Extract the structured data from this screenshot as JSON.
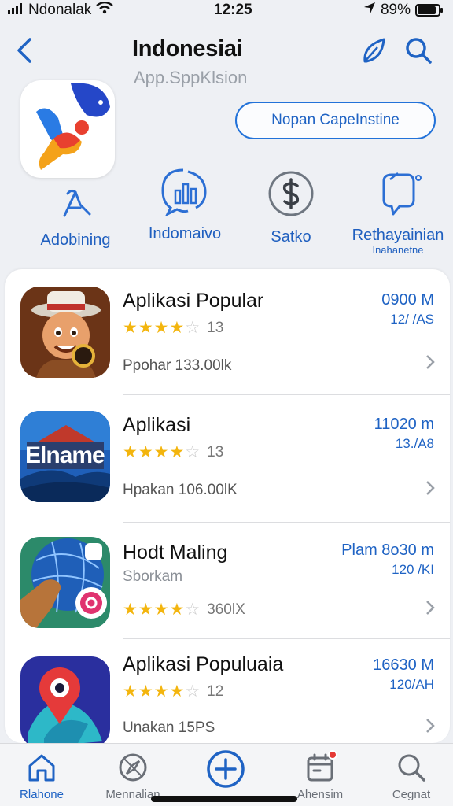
{
  "status_bar": {
    "carrier": "Ndonalak",
    "time": "12:25",
    "battery": "89%",
    "battery_level": 0.89
  },
  "header": {
    "title": "Indonesiai",
    "subtitle": "App.SppKlsion"
  },
  "cta": {
    "label": "Nopan CapeInstine"
  },
  "categories": [
    {
      "label": "Adobining",
      "icon": "touch-pointer-icon"
    },
    {
      "label": "Indomaivo",
      "icon": "chart-chat-icon"
    },
    {
      "label": "Satko",
      "icon": "money-badge-icon"
    },
    {
      "label": "Rethayainian",
      "sublabel": "Inahanetne",
      "icon": "chat-bubble-icon"
    }
  ],
  "apps": [
    {
      "name": "Aplikasi Popular",
      "stars": 3.5,
      "rating": "13",
      "meta": "Ppohar  133.00lk",
      "size": "0900 M",
      "count": "12/ /AS"
    },
    {
      "name": "Aplikasi",
      "stars": 3.5,
      "rating": "13",
      "meta": "Hpakan  106.00lK",
      "size": "11020 m",
      "count": "13./A8"
    },
    {
      "name": "Hodt Maling",
      "extra": "Sborkam",
      "stars": 3.5,
      "rating": "360lX",
      "size": "Plam 8o30 m",
      "count": "120 /KI"
    },
    {
      "name": "Aplikasi Populuaia",
      "stars": 3.5,
      "rating": "12",
      "meta": "Unakan  15PS",
      "size": "16630 M",
      "count": "120/AH"
    }
  ],
  "tabs": [
    {
      "label": "Rlahone",
      "icon": "home-icon",
      "active": true
    },
    {
      "label": "Mennalian",
      "icon": "compass-icon"
    },
    {
      "label": "",
      "icon": "add-icon"
    },
    {
      "label": "Ahensim",
      "icon": "updates-icon"
    },
    {
      "label": "Cegnat",
      "icon": "search-icon"
    }
  ],
  "colors": {
    "accent": "#1f63c4",
    "star": "#f3b50e",
    "badge": "#e53935"
  }
}
